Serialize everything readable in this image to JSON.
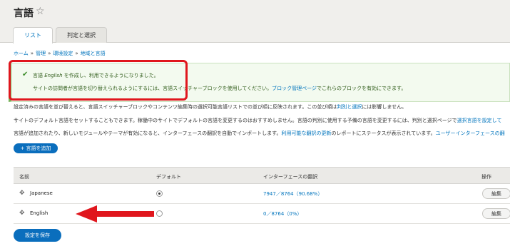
{
  "header": {
    "title": "言語",
    "star_icon": "star-icon"
  },
  "tabs": [
    {
      "label": "リスト"
    },
    {
      "label": "判定と選択"
    }
  ],
  "breadcrumb": [
    {
      "label": "ホーム"
    },
    {
      "label": "管理"
    },
    {
      "label": "環境設定"
    },
    {
      "label": "地域と言語"
    }
  ],
  "status": {
    "line1_prefix": "言語",
    "line1_em": "English",
    "line1_suffix": "を作成し、利用できるようになりました。",
    "line2_prefix": "サイトの訪問者が言語を切り替えられるようにするには、言語スイッチャーブロックを使用してください。",
    "line2_link": "ブロック管理ページ",
    "line2_suffix": "でこれらのブロックを有効にできます。",
    "color": "#77b259"
  },
  "description": {
    "line1": "設定済みの言語を並び替えると、言語スイッチャーブロックやコンテンツ編集時の選択可能言語リストでの並び順に反映されます。この並び順は",
    "line1_link": "判別と選択",
    "line1_suffix": "には影響しません。",
    "line2": "サイトのデフォルト言語をセットすることもできます。稼働中のサイトでデフォルトの言語を変更するのはおすすめしません。言語の判別に使用する予備の言語を変更するには、判別と選択ページで",
    "line2_link": "選択言語を設定して",
    "line3": "言語が追加されたり、新しいモジュールやテーマが有効になると、インターフェースの翻訳を自動でインポートします。",
    "line3_link": "利用可能な翻訳の更新",
    "line3_suffix": "のレポートにステータスが表示されています。",
    "line3_link2": "ユーザーインターフェースの翻"
  },
  "add_button": "+ 言語を追加",
  "table": {
    "headers": [
      "名前",
      "デフォルト",
      "インターフェースの翻訳",
      "操作"
    ],
    "rows": [
      {
        "name": "Japanese",
        "default": true,
        "translation": "7947／8764（90.68%）",
        "operation": "編集"
      },
      {
        "name": "English",
        "default": false,
        "translation": "0／8764（0%）",
        "operation": "編集"
      }
    ]
  },
  "save_button": "設定を保存",
  "colors": {
    "accent": "#0a6ebd",
    "link": "#0074bd",
    "highlight": "#e0161d",
    "arrow": "#e0161d"
  }
}
